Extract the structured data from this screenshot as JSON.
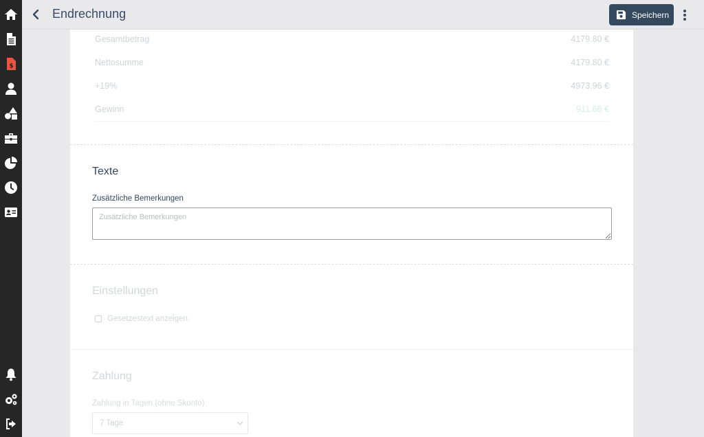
{
  "header": {
    "title": "Endrechnung",
    "save_label": "Speichern"
  },
  "sidebar": {
    "top_icons": [
      "home-icon",
      "document-icon",
      "invoice-icon",
      "user-icon",
      "shapes-icon",
      "toolbox-icon",
      "pie-chart-icon",
      "clock-icon",
      "id-card-icon"
    ],
    "bottom_icons": [
      "bell-icon",
      "cogs-icon",
      "logout-icon"
    ],
    "active_color": "#e8543f"
  },
  "summary": {
    "rows": [
      {
        "label": "Gesamtbetrag",
        "value": "4179.80 €"
      },
      {
        "label": "Nettosumme",
        "value": "4179.80 €"
      },
      {
        "label": "+19%",
        "value": "4973.96 €"
      },
      {
        "label": "Gewinn",
        "value": "911.66 €"
      }
    ]
  },
  "texte": {
    "title": "Texte",
    "notes_label": "Zusätzliche Bemerkungen",
    "notes_placeholder": "Zusätzliche Bemerkungen",
    "notes_value": ""
  },
  "einstellungen": {
    "title": "Einstellungen",
    "checkbox_label": "Gesetzestext anzeigen",
    "checked": false
  },
  "zahlung": {
    "title": "Zahlung",
    "days_label": "Zahlung in Tagen (ohne Skonto)",
    "days_value": "7 Tage"
  },
  "colors": {
    "primary": "#34495e",
    "sidebar_bg": "#262626",
    "background": "#e9e8ea"
  }
}
